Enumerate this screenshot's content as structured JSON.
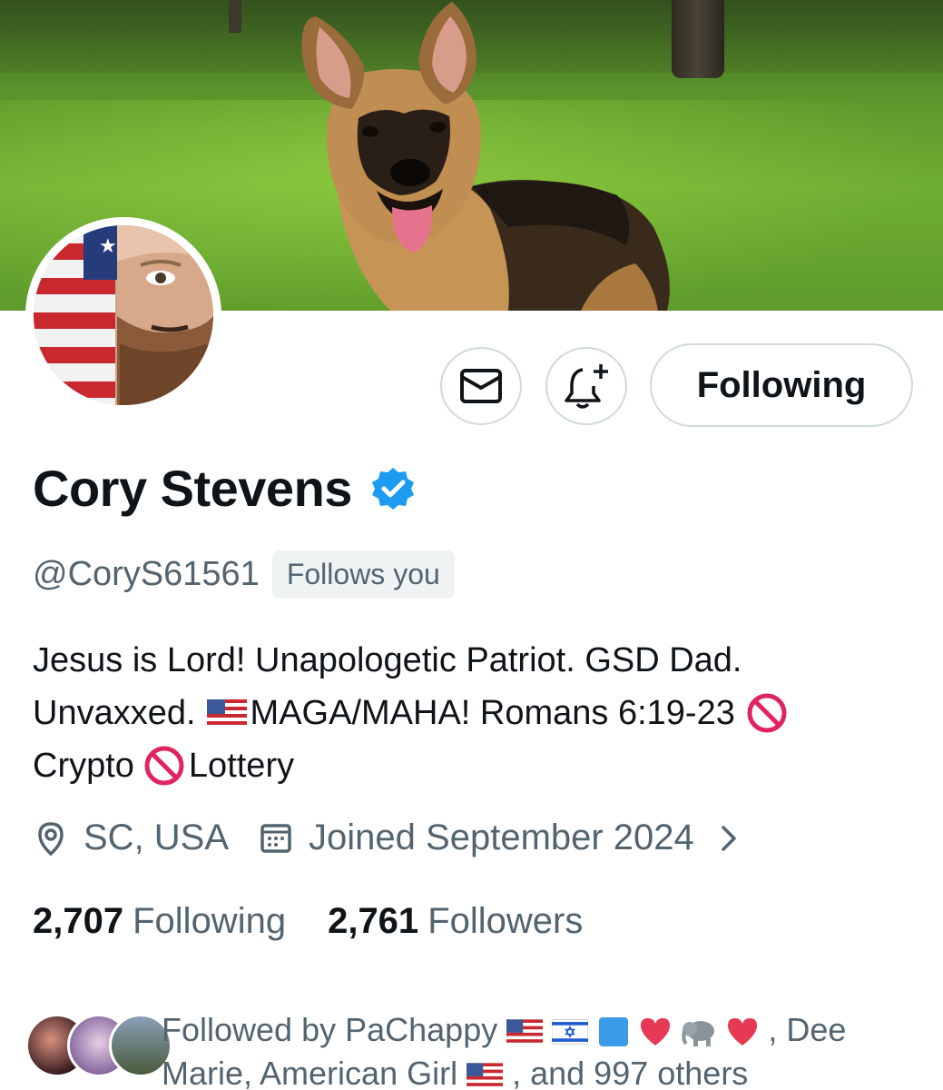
{
  "profile": {
    "display_name": "Cory Stevens",
    "handle": "@CoryS61561",
    "follows_you_badge": "Follows you",
    "bio": {
      "line1": "Jesus is Lord! Unapologetic Patriot. GSD Dad.",
      "line2_a": "Unvaxxed.",
      "line2_b": "MAGA/MAHA! Romans 6:19-23",
      "line3_a": "Crypto",
      "line3_b": "Lottery"
    },
    "location": "SC, USA",
    "joined": "Joined September 2024"
  },
  "actions": {
    "following_label": "Following"
  },
  "stats": {
    "following_count": "2,707",
    "following_label": "Following",
    "followers_count": "2,761",
    "followers_label": "Followers"
  },
  "followed_by": {
    "prefix": "Followed by PaChappy",
    "middle": ", Dee",
    "line2_a": "Marie, American Girl",
    "line2_b": ", and 997 others"
  },
  "icons": {
    "message": "envelope-icon",
    "notify": "bell-plus-icon",
    "verified": "verified-badge-icon",
    "location": "location-pin-icon",
    "calendar": "calendar-icon",
    "chevron": "chevron-right-icon"
  },
  "colors": {
    "text_primary": "#0f1419",
    "text_secondary": "#536471",
    "border": "#cfd9de",
    "verified_blue": "#1d9bf0",
    "badge_bg": "#eff3f4"
  }
}
